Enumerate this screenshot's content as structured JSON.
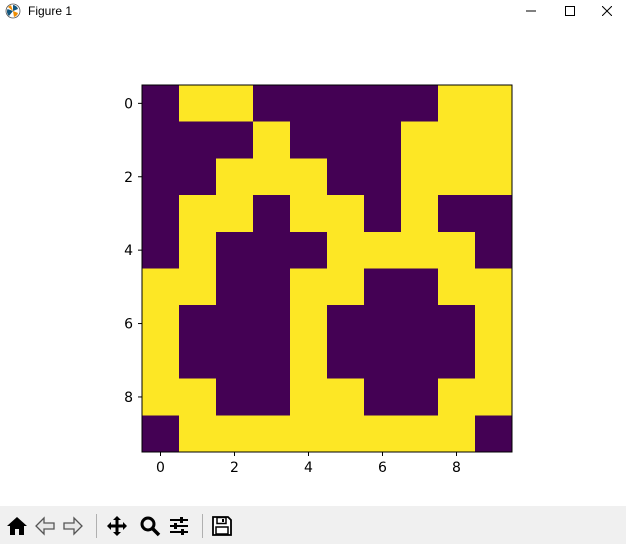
{
  "window": {
    "title": "Figure 1",
    "minimize_icon": "minimize-icon",
    "maximize_icon": "maximize-icon",
    "close_icon": "close-icon"
  },
  "toolbar": {
    "buttons": [
      {
        "name": "home-button",
        "icon": "home-icon"
      },
      {
        "name": "back-button",
        "icon": "back-arrow-icon"
      },
      {
        "name": "forward-button",
        "icon": "forward-arrow-icon"
      },
      {
        "name": "pan-button",
        "icon": "move-icon"
      },
      {
        "name": "zoom-button",
        "icon": "zoom-icon"
      },
      {
        "name": "configure-subplots-button",
        "icon": "sliders-icon"
      },
      {
        "name": "save-button",
        "icon": "save-icon"
      }
    ]
  },
  "chart_data": {
    "type": "heatmap",
    "title": "",
    "xlabel": "",
    "ylabel": "",
    "colors": {
      "0": "#440154",
      "1": "#fde725"
    },
    "xticks": [
      0,
      2,
      4,
      6,
      8
    ],
    "yticks": [
      0,
      2,
      4,
      6,
      8
    ],
    "xlim": [
      -0.5,
      9.5
    ],
    "ylim": [
      9.5,
      -0.5
    ],
    "grid": [
      [
        0,
        1,
        1,
        0,
        0,
        0,
        0,
        0,
        1,
        1
      ],
      [
        0,
        0,
        0,
        1,
        0,
        0,
        0,
        1,
        1,
        1
      ],
      [
        0,
        0,
        1,
        1,
        1,
        0,
        0,
        1,
        1,
        1
      ],
      [
        0,
        1,
        1,
        0,
        1,
        1,
        0,
        1,
        0,
        0
      ],
      [
        0,
        1,
        0,
        0,
        0,
        1,
        1,
        1,
        1,
        0
      ],
      [
        1,
        1,
        0,
        0,
        1,
        1,
        0,
        0,
        1,
        1
      ],
      [
        1,
        0,
        0,
        0,
        1,
        0,
        0,
        0,
        0,
        1
      ],
      [
        1,
        0,
        0,
        0,
        1,
        0,
        0,
        0,
        0,
        1
      ],
      [
        1,
        1,
        0,
        0,
        1,
        1,
        0,
        0,
        1,
        1
      ],
      [
        0,
        1,
        1,
        1,
        1,
        1,
        1,
        1,
        1,
        0
      ]
    ]
  }
}
